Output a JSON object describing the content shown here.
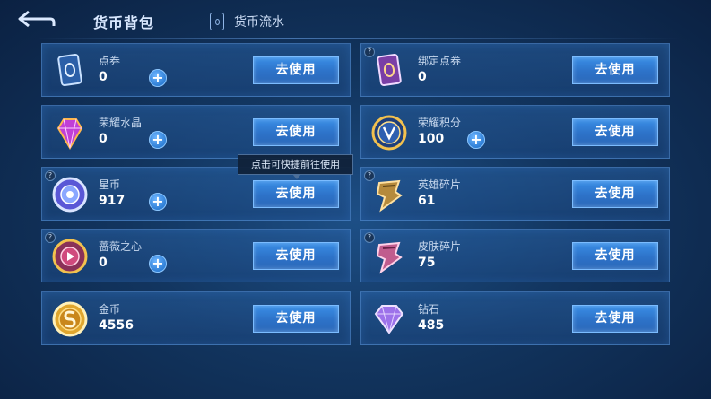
{
  "header": {
    "active_tab": "货币背包",
    "flow_tab": "货币流水"
  },
  "tooltip": "点击可快捷前往使用",
  "cards": [
    {
      "name": "点券",
      "value": "0",
      "button": "去使用"
    },
    {
      "name": "绑定点券",
      "value": "0",
      "button": "去使用"
    },
    {
      "name": "荣耀水晶",
      "value": "0",
      "button": "去使用"
    },
    {
      "name": "荣耀积分",
      "value": "100",
      "button": "去使用"
    },
    {
      "name": "星币",
      "value": "917",
      "button": "去使用"
    },
    {
      "name": "英雄碎片",
      "value": "61",
      "button": "去使用"
    },
    {
      "name": "蔷薇之心",
      "value": "0",
      "button": "去使用"
    },
    {
      "name": "皮肤碎片",
      "value": "75",
      "button": "去使用"
    },
    {
      "name": "金币",
      "value": "4556",
      "button": "去使用"
    },
    {
      "name": "钻石",
      "value": "485",
      "button": "去使用"
    }
  ],
  "help_mark": "?",
  "plus_mark": "+",
  "colors": {
    "button": "#2d72c8",
    "card_border": "#5d9ee6",
    "background": "#12355f"
  }
}
